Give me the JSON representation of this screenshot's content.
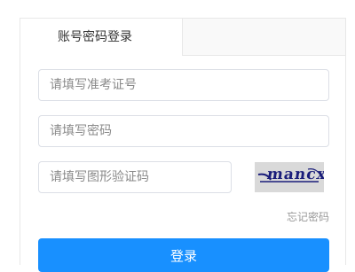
{
  "tabs": {
    "account_login": "账号密码登录"
  },
  "form": {
    "exam_id_placeholder": "请填写准考证号",
    "password_placeholder": "请填写密码",
    "captcha_placeholder": "请填写图形验证码",
    "captcha_text": "mancx",
    "forgot_label": "忘记密码",
    "login_label": "登录"
  },
  "colors": {
    "primary": "#1890ff",
    "border": "#dcdfe6",
    "captcha_bg": "#d9d9d9",
    "captcha_ink": "#1a1d7a"
  }
}
